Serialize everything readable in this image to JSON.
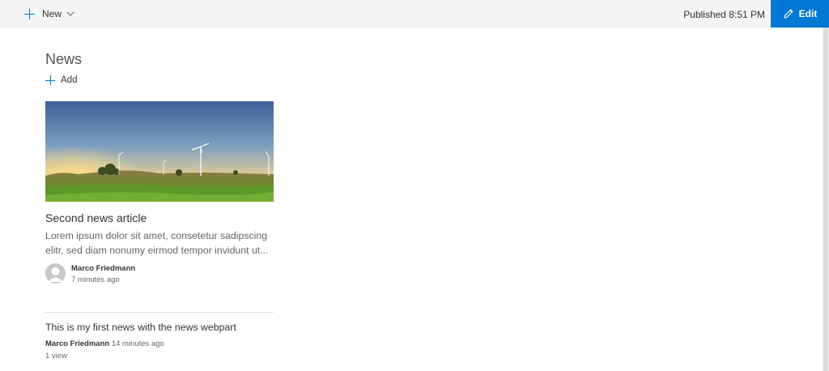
{
  "command_bar": {
    "new_label": "New",
    "published_text": "Published 8:51 PM",
    "edit_label": "Edit",
    "accent": "#0078d4"
  },
  "news": {
    "title": "News",
    "add_label": "Add",
    "featured": {
      "title": "Second news article",
      "description": "Lorem ipsum dolor sit amet, consetetur sadipscing elitr, sed diam nonumy eirmod tempor invidunt ut...",
      "author": "Marco Friedmann",
      "time": "7 minutes ago"
    },
    "items": [
      {
        "title": "This is my first news with the news webpart",
        "author": "Marco Friedmann",
        "time": "14 minutes ago",
        "views": "1 view"
      }
    ]
  }
}
